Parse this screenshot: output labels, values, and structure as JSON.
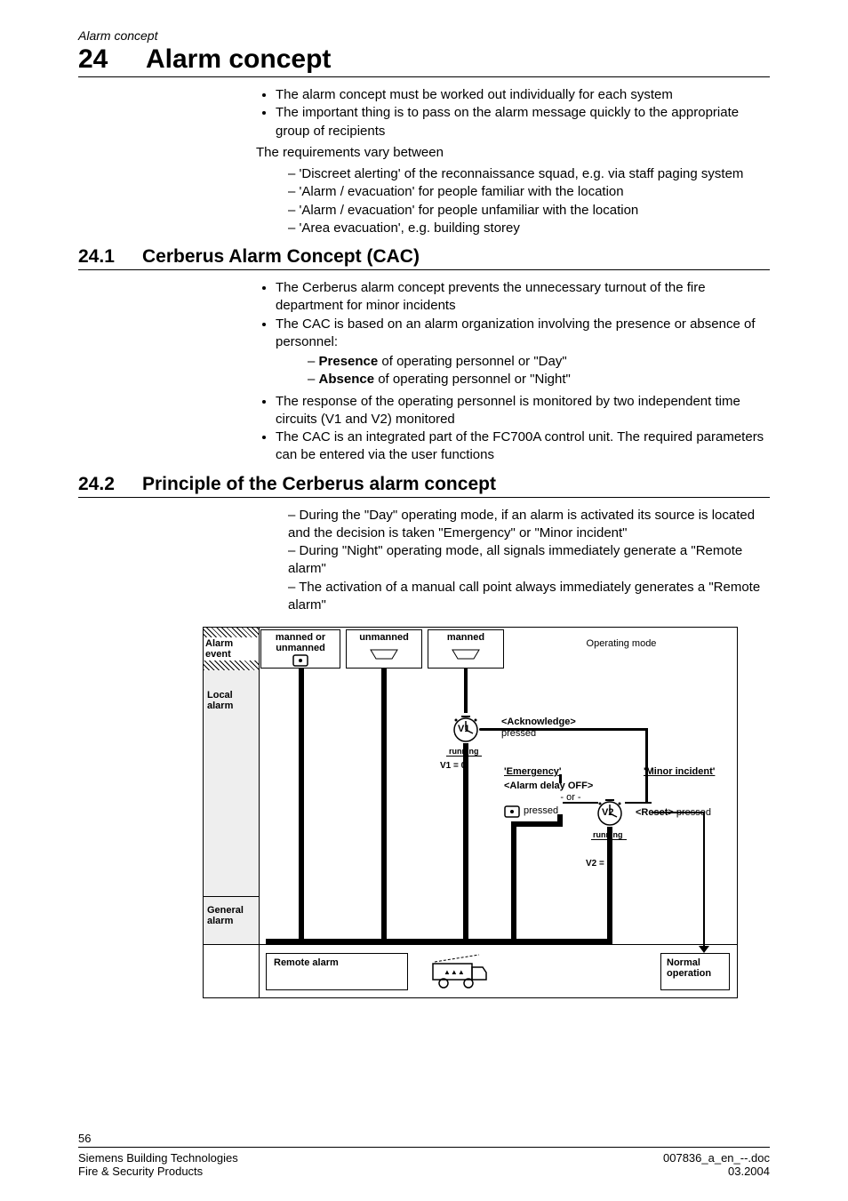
{
  "running_head": "Alarm concept",
  "h1": {
    "num": "24",
    "title": "Alarm concept"
  },
  "intro": {
    "bullets": [
      "The alarm concept must be worked out individually for each system",
      "The important thing is to pass on the alarm message quickly to the appropriate group of recipients"
    ],
    "req_line": "The requirements vary between",
    "dashes": [
      "'Discreet alerting' of the reconnaissance squad, e.g. via staff paging system",
      "'Alarm / evacuation' for people familiar with the location",
      "'Alarm / evacuation' for people unfamiliar with the location",
      "'Area evacuation', e.g. building storey"
    ]
  },
  "s241": {
    "num": "24.1",
    "title": "Cerberus Alarm Concept (CAC)",
    "items": [
      {
        "text": "The Cerberus alarm concept prevents the unnecessary turnout of the fire department for minor incidents"
      },
      {
        "text": "The CAC is based on an alarm organization involving the presence or absence of personnel:",
        "sub": [
          {
            "bold": "Presence",
            "rest": " of operating personnel or \"Day\""
          },
          {
            "bold": "Absence",
            "rest": " of operating personnel or \"Night\""
          }
        ]
      },
      {
        "text": "The response of the operating personnel is monitored by two independent time circuits  (V1 and V2) monitored"
      },
      {
        "text": "The CAC is an integrated part of the FC700A control unit. The required parameters can be entered via the user functions"
      }
    ]
  },
  "s242": {
    "num": "24.2",
    "title": "Principle of the Cerberus alarm concept",
    "dashes": [
      "During the \"Day\" operating mode, if an alarm is activated its source is located and the decision is taken \"Emergency\" or \"Minor incident\"",
      "During \"Night\" operating mode, all signals immediately generate a  \"Remote alarm\"",
      "The activation of a manual call point always immediately generates a \"Remote alarm\""
    ]
  },
  "diagram": {
    "alarm_event": "Alarm event",
    "manned_or_unmanned": "manned or unmanned",
    "unmanned": "unmanned",
    "manned": "manned",
    "operating_mode": "Operating mode",
    "local_alarm": "Local alarm",
    "general_alarm": "General alarm",
    "remote_alarm": "Remote alarm",
    "normal_operation": "Normal operation",
    "v1": "V1",
    "v1_running": "running",
    "v1_zero": "V1 = 0",
    "ack_bold": "<Acknowledge>",
    "ack_rest": "pressed",
    "emergency": "'Emergency'",
    "minor": "'Minor incident'",
    "delay_off": "<Alarm delay OFF>",
    "or": "- or -",
    "mcp_pressed": "pressed",
    "v2": "V2",
    "v2_running": "running",
    "v2_zero": "V2 = 0",
    "reset": "<Reset>",
    "reset_rest": " pressed",
    "icons": {
      "mcp": "manual-call-point-icon",
      "detector": "detector-icon",
      "timer": "timer-icon",
      "fire_truck": "fire-truck-icon"
    }
  },
  "footer": {
    "page": "56",
    "left1": "Siemens Building Technologies",
    "left2": "Fire & Security Products",
    "right1": "007836_a_en_--.doc",
    "right2": "03.2004"
  }
}
